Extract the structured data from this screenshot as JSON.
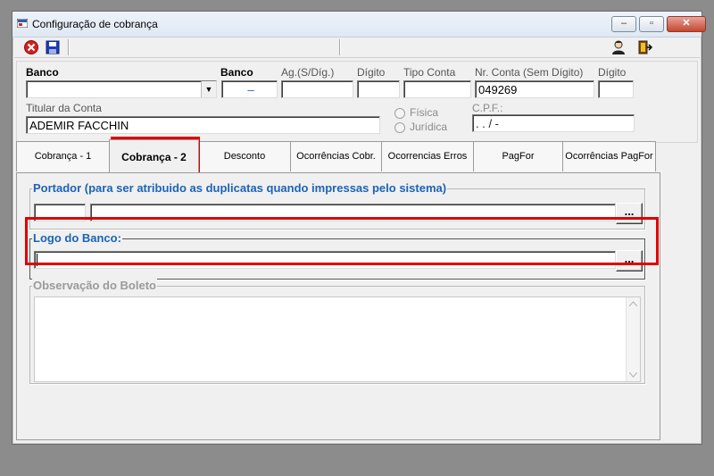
{
  "window": {
    "title": "Configuração de cobrança",
    "btn_min": "–",
    "btn_max": "▫",
    "btn_close": "✕"
  },
  "toolbar": {
    "icons": [
      "close-red-icon",
      "save-disk-icon",
      "user-icon",
      "exit-door-icon"
    ]
  },
  "header": {
    "banco_label": "Banco",
    "banco_value": "",
    "banco2_label": "Banco",
    "banco2_value": "–",
    "ag_label": "Ag.(S/Díg.)",
    "ag_value": "",
    "digito_label": "Dígito",
    "digito_value": "",
    "tipo_conta_label": "Tipo Conta",
    "tipo_conta_value": "",
    "nr_conta_label": "Nr. Conta (Sem Dígito)",
    "nr_conta_value": "049269",
    "digito2_label": "Dígito",
    "digito2_value": "",
    "titular_label": "Titular da Conta",
    "titular_value": "ADEMIR FACCHIN",
    "radio_fisica": "Física",
    "radio_juridica": "Jurídica",
    "cpf_label": "C.P.F.:",
    "cpf_value": ".   .   /   -"
  },
  "tabs": [
    "Cobrança - 1",
    "Cobrança - 2",
    "Desconto",
    "Ocorrências Cobr.",
    "Ocorrencias Erros",
    "PagFor",
    "Ocorrências PagFor"
  ],
  "active_tab": "Cobrança - 2",
  "tab2": {
    "portador_legend": "Portador (para ser atribuido as duplicatas quando impressas pelo sistema)",
    "portador_code": "",
    "portador_name": "",
    "logo_legend": "Logo do Banco:",
    "logo_value": "",
    "browse_label": "...",
    "obs_legend": "Observação do Boleto",
    "obs_value": ""
  },
  "colors": {
    "legend_blue": "#1c63b7",
    "highlight_red": "#e00000"
  }
}
